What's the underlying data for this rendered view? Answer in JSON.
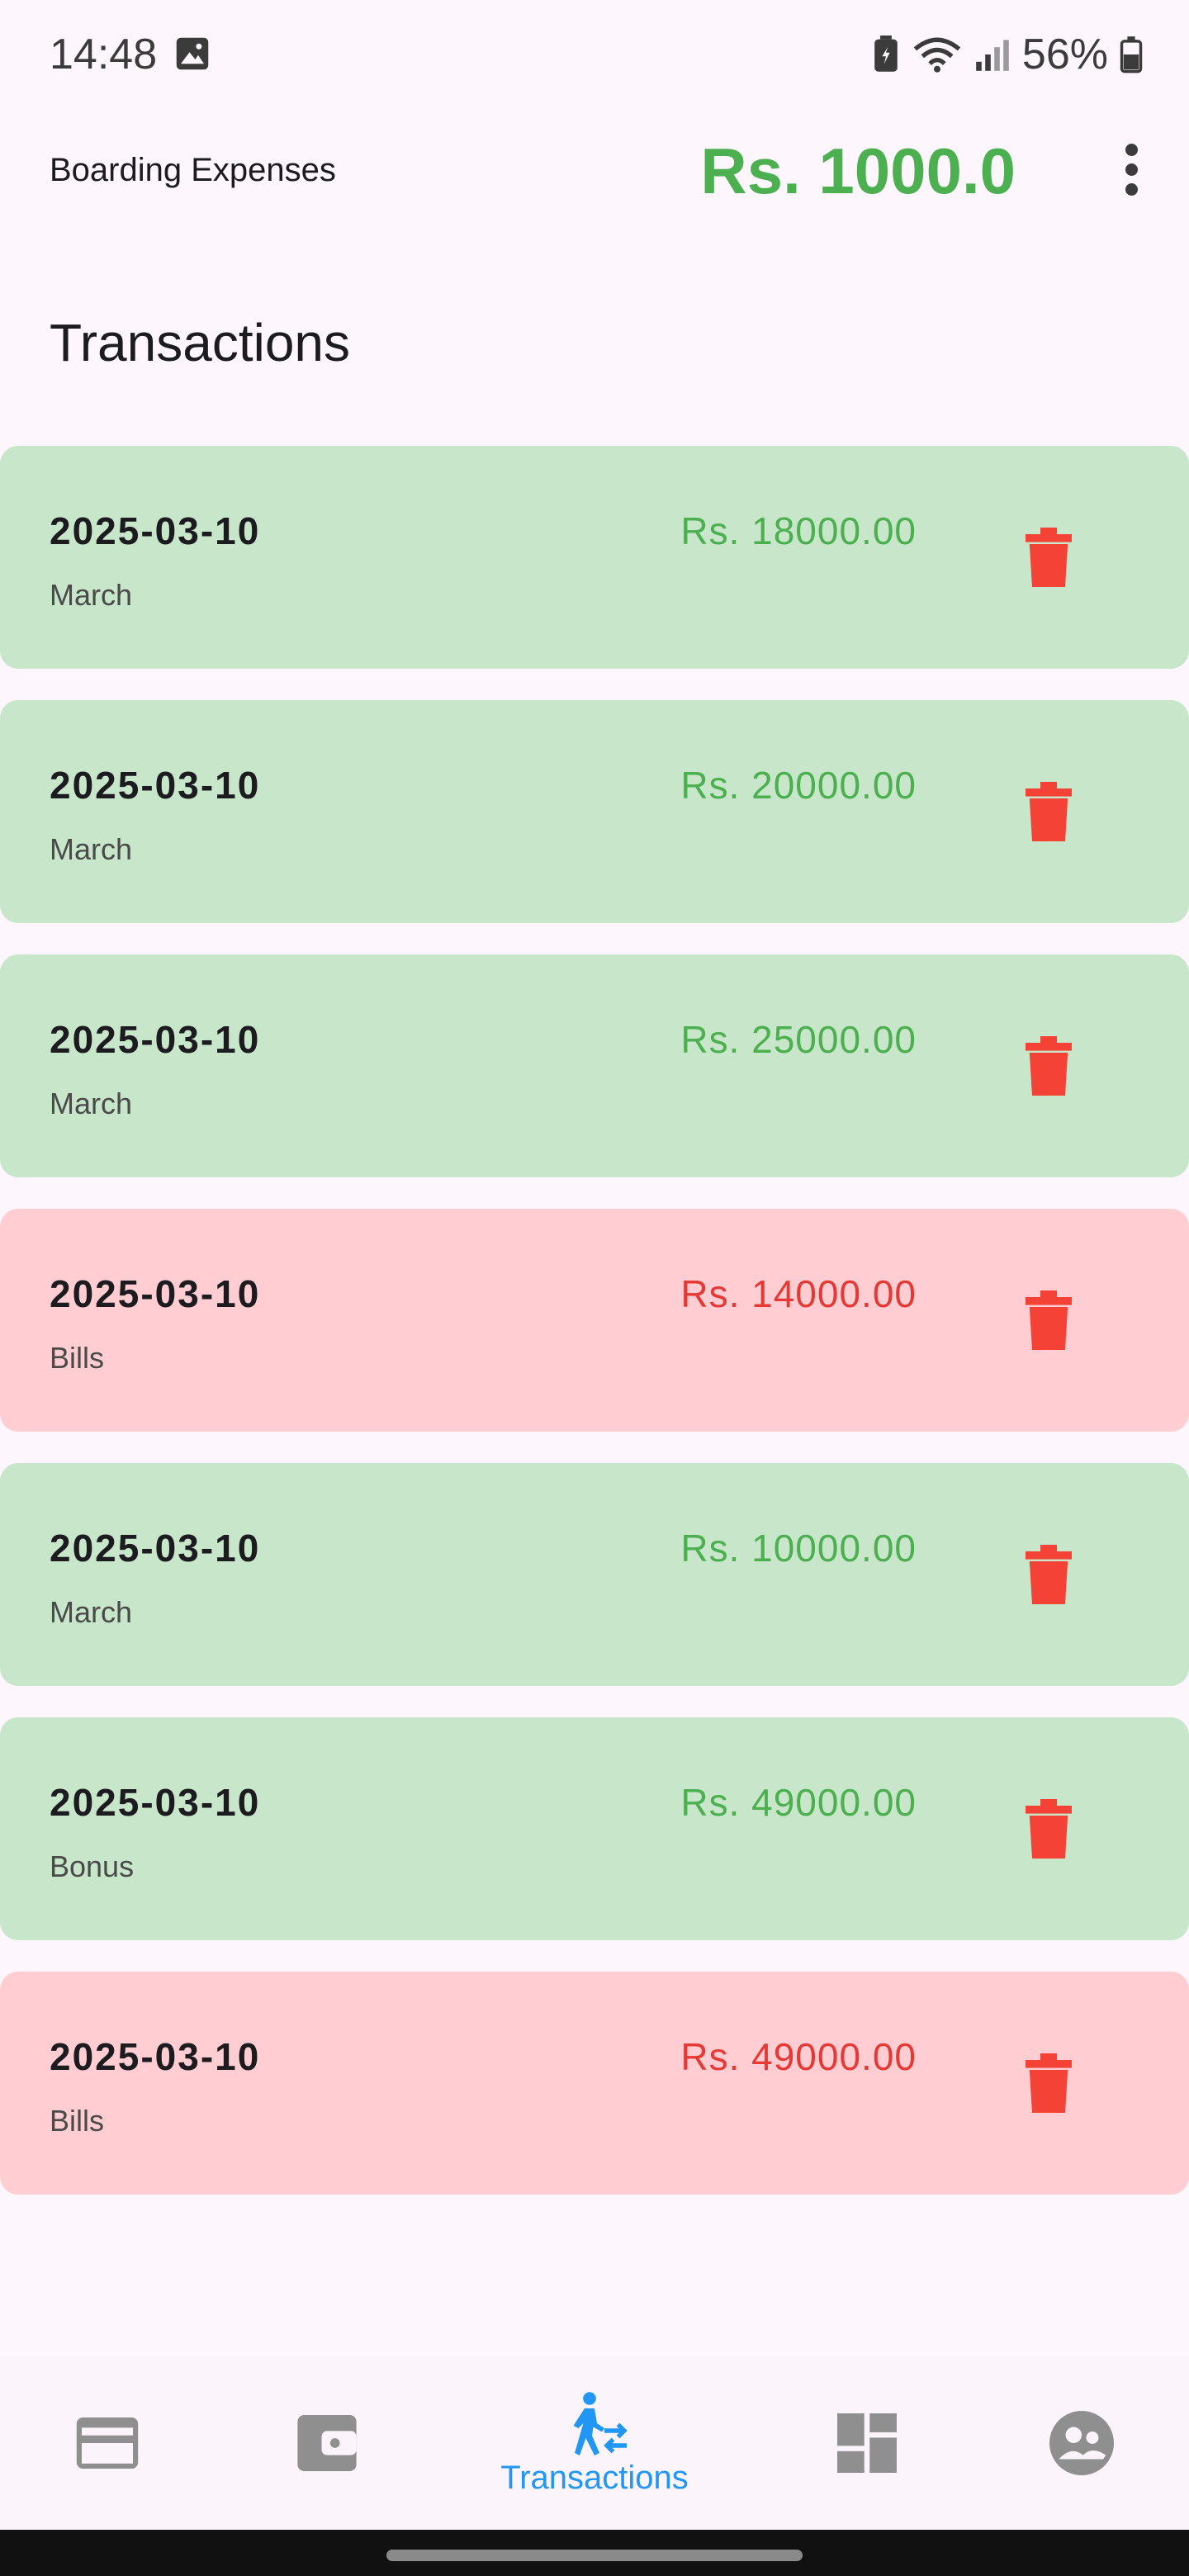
{
  "status_bar": {
    "time": "14:48",
    "battery_percent": "56%"
  },
  "app_bar": {
    "title": "Boarding Expenses",
    "balance": "Rs. 1000.0"
  },
  "section_title": "Transactions",
  "colors": {
    "income_bg": "#c8e6c9",
    "expense_bg": "#ffcdd2",
    "income_text": "#4caf50",
    "expense_text": "#e53935",
    "accent": "#2196f3"
  },
  "transactions": [
    {
      "date": "2025-03-10",
      "category": "March",
      "amount": "Rs. 18000.00",
      "type": "income"
    },
    {
      "date": "2025-03-10",
      "category": "March",
      "amount": "Rs. 20000.00",
      "type": "income"
    },
    {
      "date": "2025-03-10",
      "category": "March",
      "amount": "Rs. 25000.00",
      "type": "income"
    },
    {
      "date": "2025-03-10",
      "category": "Bills",
      "amount": "Rs. 14000.00",
      "type": "expense"
    },
    {
      "date": "2025-03-10",
      "category": "March",
      "amount": "Rs. 10000.00",
      "type": "income"
    },
    {
      "date": "2025-03-10",
      "category": "Bonus",
      "amount": "Rs. 49000.00",
      "type": "income"
    },
    {
      "date": "2025-03-10",
      "category": "Bills",
      "amount": "Rs. 49000.00",
      "type": "expense"
    }
  ],
  "bottom_nav": {
    "active_label": "Transactions",
    "items": [
      {
        "icon": "credit-card-icon"
      },
      {
        "icon": "wallet-icon"
      },
      {
        "icon": "transactions-icon",
        "label": "Transactions",
        "active": true
      },
      {
        "icon": "dashboard-icon"
      },
      {
        "icon": "account-icon"
      }
    ]
  }
}
